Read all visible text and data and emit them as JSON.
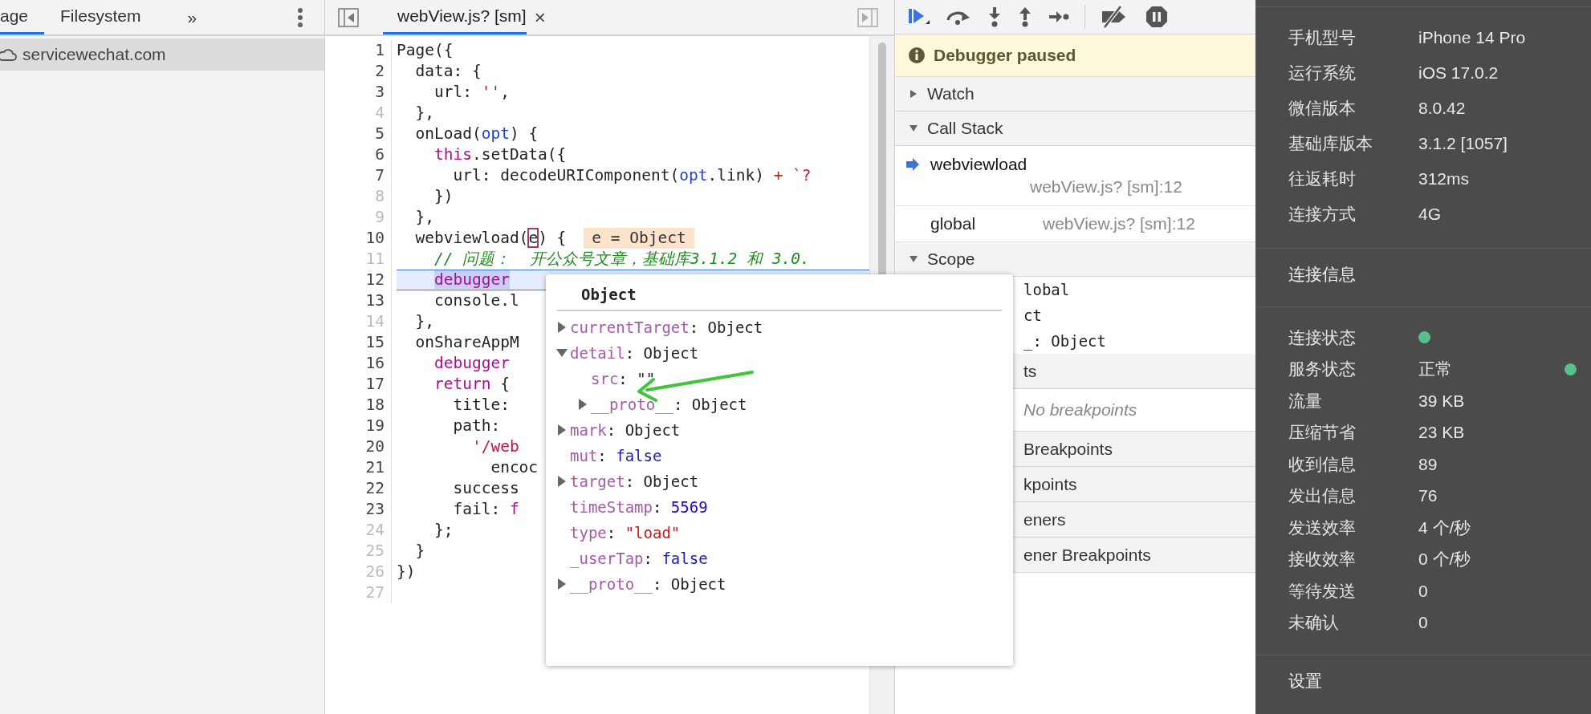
{
  "navigator": {
    "tabs": [
      {
        "label": "age",
        "selected": true
      },
      {
        "label": "Filesystem",
        "selected": false
      }
    ],
    "more_tabs": "»",
    "tree": [
      {
        "label": "servicewechat.com",
        "selected": true
      }
    ]
  },
  "editor": {
    "tabs": [
      {
        "label": "webView.js? [sm]",
        "selected": true,
        "close": "×"
      }
    ],
    "lines": [
      {
        "number": "1",
        "breakable": true,
        "tokens": [
          {
            "text": "Page({",
            "kind": "plain"
          }
        ]
      },
      {
        "number": "2",
        "breakable": true,
        "tokens": [
          {
            "text": "  data: {",
            "kind": "plain"
          }
        ]
      },
      {
        "number": "3",
        "breakable": true,
        "tokens": [
          {
            "text": "    url: ",
            "kind": "plain"
          },
          {
            "text": "''",
            "kind": "string"
          },
          {
            "text": ",",
            "kind": "plain"
          }
        ]
      },
      {
        "number": "4",
        "breakable": false,
        "tokens": [
          {
            "text": "  },",
            "kind": "plain"
          }
        ]
      },
      {
        "number": "5",
        "breakable": true,
        "tokens": [
          {
            "text": "  onLoad(",
            "kind": "plain"
          },
          {
            "text": "opt",
            "kind": "param"
          },
          {
            "text": ") {",
            "kind": "plain"
          }
        ]
      },
      {
        "number": "6",
        "breakable": true,
        "tokens": [
          {
            "text": "    this",
            "kind": "keyword"
          },
          {
            "text": ".setData({",
            "kind": "plain"
          }
        ]
      },
      {
        "number": "7",
        "breakable": true,
        "tokens": [
          {
            "text": "      url: decodeURIComponent(",
            "kind": "plain"
          },
          {
            "text": "opt",
            "kind": "param"
          },
          {
            "text": ".link) ",
            "kind": "plain"
          },
          {
            "text": "+",
            "kind": "operator"
          },
          {
            "text": " `?",
            "kind": "string"
          }
        ]
      },
      {
        "number": "8",
        "breakable": false,
        "tokens": [
          {
            "text": "    })",
            "kind": "plain"
          }
        ]
      },
      {
        "number": "9",
        "breakable": false,
        "tokens": [
          {
            "text": "  },",
            "kind": "plain"
          }
        ]
      },
      {
        "number": "10",
        "breakable": true,
        "tokens": [
          {
            "text": "  webviewload(",
            "kind": "plain"
          },
          {
            "text": "e",
            "kind": "boxed"
          },
          {
            "text": ") {",
            "kind": "plain"
          }
        ],
        "inline_value": "e = Object"
      },
      {
        "number": "11",
        "breakable": false,
        "tokens": [
          {
            "text": "    // 问题：  开公众号文章，基础库3.1.2 和 3.0.",
            "kind": "comment"
          }
        ]
      },
      {
        "number": "12",
        "breakable": true,
        "current": true,
        "tokens": [
          {
            "text": "    debugger",
            "kind": "keyword",
            "highlighted": true
          }
        ]
      },
      {
        "number": "13",
        "breakable": true,
        "tokens": [
          {
            "text": "    console.l",
            "kind": "plain"
          }
        ]
      },
      {
        "number": "14",
        "breakable": false,
        "tokens": [
          {
            "text": "  },",
            "kind": "plain"
          }
        ]
      },
      {
        "number": "15",
        "breakable": true,
        "tokens": [
          {
            "text": "  onShareAppM",
            "kind": "plain"
          }
        ]
      },
      {
        "number": "16",
        "breakable": true,
        "tokens": [
          {
            "text": "    debugger",
            "kind": "keyword"
          }
        ]
      },
      {
        "number": "17",
        "breakable": true,
        "tokens": [
          {
            "text": "    return",
            "kind": "keyword"
          },
          {
            "text": " {",
            "kind": "plain"
          }
        ]
      },
      {
        "number": "18",
        "breakable": true,
        "tokens": [
          {
            "text": "      title:",
            "kind": "plain"
          }
        ]
      },
      {
        "number": "19",
        "breakable": true,
        "tokens": [
          {
            "text": "      path:",
            "kind": "plain"
          }
        ]
      },
      {
        "number": "20",
        "breakable": true,
        "tokens": [
          {
            "text": "        '/web",
            "kind": "string"
          }
        ]
      },
      {
        "number": "21",
        "breakable": true,
        "tokens": [
          {
            "text": "          encoc",
            "kind": "plain"
          }
        ]
      },
      {
        "number": "22",
        "breakable": true,
        "tokens": [
          {
            "text": "      success",
            "kind": "plain"
          }
        ]
      },
      {
        "number": "23",
        "breakable": true,
        "tokens": [
          {
            "text": "      fail: ",
            "kind": "plain"
          },
          {
            "text": "f",
            "kind": "keyword"
          }
        ]
      },
      {
        "number": "24",
        "breakable": false,
        "tokens": [
          {
            "text": "    };",
            "kind": "plain"
          }
        ]
      },
      {
        "number": "25",
        "breakable": false,
        "tokens": [
          {
            "text": "  }",
            "kind": "plain"
          }
        ]
      },
      {
        "number": "26",
        "breakable": false,
        "tokens": [
          {
            "text": "})",
            "kind": "plain"
          }
        ]
      },
      {
        "number": "27",
        "breakable": false
      }
    ]
  },
  "popup": {
    "title": "Object",
    "properties": [
      {
        "name": "currentTarget",
        "separator": ":",
        "value": "Object",
        "kind": "object",
        "expandable": true,
        "expanded": false
      },
      {
        "name": "detail",
        "separator": ":",
        "value": "Object",
        "kind": "object",
        "expandable": true,
        "expanded": true,
        "children": [
          {
            "name": "src",
            "separator": ":",
            "value": "\"\"",
            "kind": "object",
            "expandable": false
          },
          {
            "name": "__proto__",
            "separator": ":",
            "value": "Object",
            "kind": "object",
            "expandable": true,
            "expanded": false
          }
        ]
      },
      {
        "name": "mark",
        "separator": ":",
        "value": "Object",
        "kind": "object",
        "expandable": true,
        "expanded": false
      },
      {
        "name": "mut",
        "separator": ":",
        "value": "false",
        "kind": "boolean",
        "expandable": false
      },
      {
        "name": "target",
        "separator": ":",
        "value": "Object",
        "kind": "object",
        "expandable": true,
        "expanded": false
      },
      {
        "name": "timeStamp",
        "separator": ":",
        "value": "5569",
        "kind": "number",
        "expandable": false
      },
      {
        "name": "type",
        "separator": ":",
        "value": "\"load\"",
        "kind": "string",
        "expandable": false
      },
      {
        "name": "_userTap",
        "separator": ":",
        "value": "false",
        "kind": "boolean",
        "expandable": false
      },
      {
        "name": "__proto__",
        "separator": ":",
        "value": "Object",
        "kind": "object",
        "expandable": true,
        "expanded": false
      }
    ]
  },
  "debugger": {
    "banner": "Debugger paused",
    "sidebar": [
      {
        "kind": "section",
        "label": "Watch",
        "expanded": false
      },
      {
        "kind": "section",
        "label": "Call Stack",
        "expanded": true
      },
      {
        "kind": "frame",
        "label": "webviewload",
        "location": "webView.js? [sm]:12",
        "selected": true
      },
      {
        "kind": "frame",
        "label": "global",
        "location": "webView.js? [sm]:12",
        "selected": false
      },
      {
        "kind": "section",
        "label": "Scope",
        "expanded": true
      },
      {
        "kind": "value",
        "label": "lobal"
      },
      {
        "kind": "value",
        "label": "ct"
      },
      {
        "kind": "value",
        "label": "_: Object"
      },
      {
        "kind": "covered_section",
        "label": "ts"
      },
      {
        "kind": "note",
        "label": "No breakpoints"
      },
      {
        "kind": "covered_section",
        "label": "Breakpoints"
      },
      {
        "kind": "covered_section",
        "label": "kpoints"
      },
      {
        "kind": "covered_section",
        "label": "eners"
      },
      {
        "kind": "covered_section",
        "label": "ener Breakpoints"
      }
    ]
  },
  "device_panel": {
    "device_info": [
      {
        "label": "手机型号",
        "value": "iPhone 14 Pro"
      },
      {
        "label": "运行系统",
        "value": "iOS 17.0.2"
      },
      {
        "label": "微信版本",
        "value": "8.0.42"
      },
      {
        "label": "基础库版本",
        "value": "3.1.2 [1057]"
      },
      {
        "label": "往返耗时",
        "value": "312ms"
      },
      {
        "label": "连接方式",
        "value": "4G"
      }
    ],
    "connection_heading": "连接信息",
    "connection_info": [
      {
        "label": "连接状态",
        "online": true
      },
      {
        "label": "服务状态",
        "value": "正常",
        "online": true
      },
      {
        "label": "流量",
        "value": "39 KB"
      },
      {
        "label": "压缩节省",
        "value": "23 KB"
      },
      {
        "label": "收到信息",
        "value": "89"
      },
      {
        "label": "发出信息",
        "value": "76"
      },
      {
        "label": "发送效率",
        "value": "4 个/秒"
      },
      {
        "label": "接收效率",
        "value": "0 个/秒"
      },
      {
        "label": "等待发送",
        "value": "0"
      },
      {
        "label": "未确认",
        "value": "0"
      }
    ],
    "settings_heading": "设置"
  }
}
